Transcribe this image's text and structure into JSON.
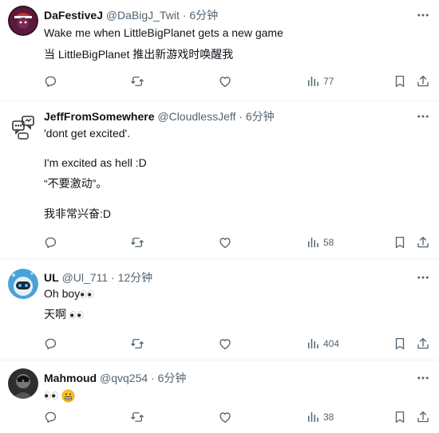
{
  "tweets": [
    {
      "name": "DaFestiveJ",
      "handle": "@DaBigJ_Twit",
      "sep": "·",
      "time": "6分钟",
      "lines": [
        "Wake me when LittleBigPlanet gets a new game",
        "当 LittleBigPlanet 推出新游戏时唤醒我"
      ],
      "views": "77"
    },
    {
      "name": "JeffFromSomewhere",
      "handle": "@CloudlessJeff",
      "sep": "·",
      "time": "6分钟",
      "lines": [
        "'dont get excited'.",
        "I'm excited as hell :D",
        "“不要激动”。",
        "我非常兴奋:D"
      ],
      "views": "58"
    },
    {
      "name": "UL",
      "handle": "@Ul_711",
      "sep": "·",
      "time": "12分钟",
      "lines": [
        "Oh  boy",
        "天啊 "
      ],
      "views": "404"
    },
    {
      "name": "Mahmoud",
      "handle": "@qvq254",
      "sep": "·",
      "time": "6分钟",
      "lines": [
        ""
      ],
      "views": "38"
    }
  ],
  "icons": {
    "more": "more-dots-icon",
    "reply": "reply-icon",
    "repost": "repost-icon",
    "like": "like-icon",
    "views": "views-icon",
    "bookmark": "bookmark-icon",
    "share": "share-icon"
  },
  "colors": {
    "text": "#0f1419",
    "secondary": "#536471",
    "divider": "#eff3f4"
  }
}
